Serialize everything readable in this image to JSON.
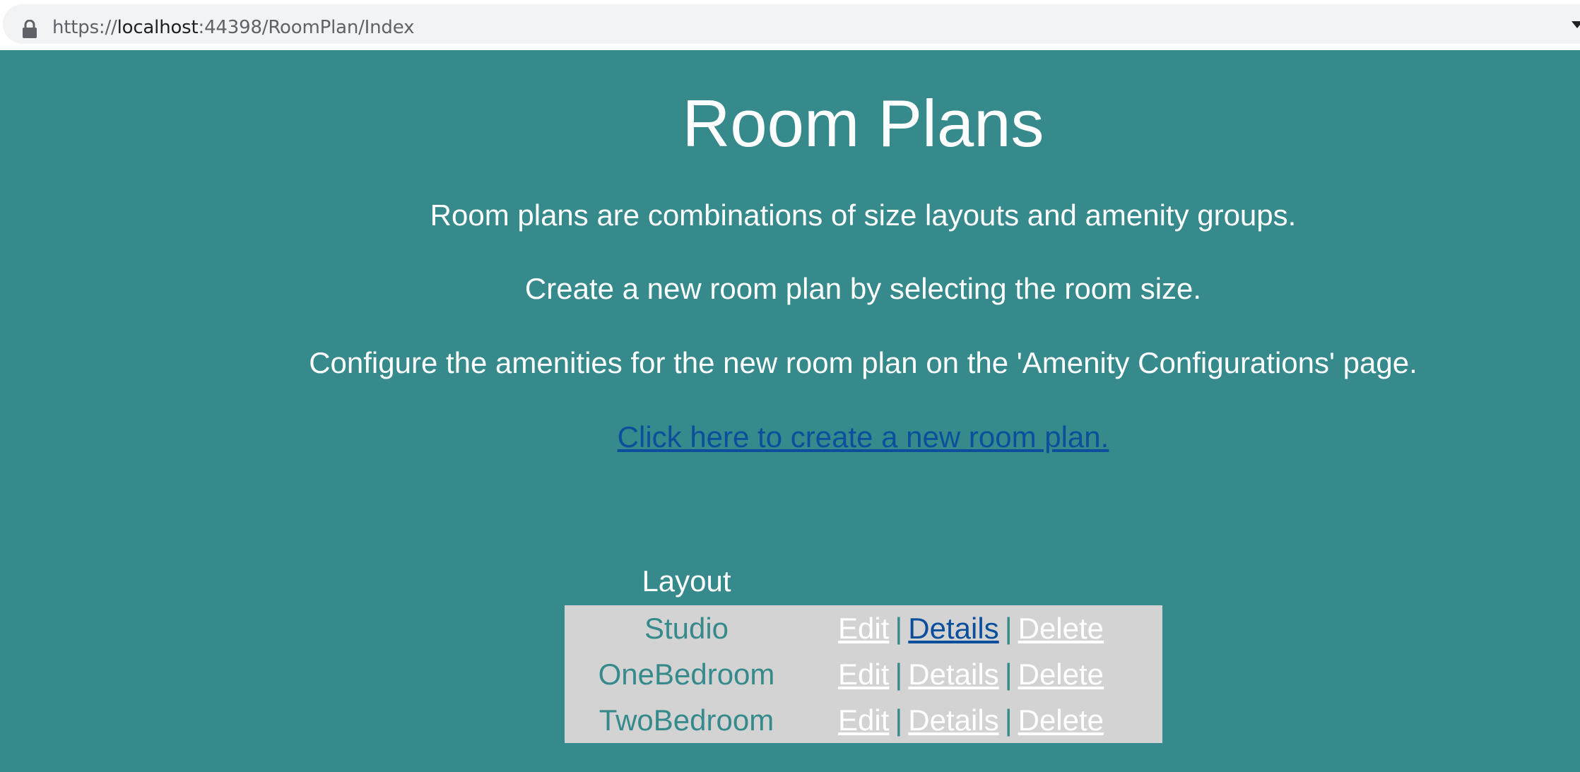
{
  "browser": {
    "url_scheme": "https://",
    "url_host": "localhost",
    "url_rest": ":44398/RoomPlan/Index"
  },
  "page": {
    "title": "Room Plans",
    "paragraphs": [
      "Room plans are combinations of size layouts and amenity groups.",
      "Create a new room plan by selecting the room size.",
      "Configure the amenities for the new room plan on the 'Amenity Configurations' page."
    ],
    "create_link": "Click here to create a new room plan."
  },
  "table": {
    "header_layout": "Layout",
    "rows": [
      {
        "layout": "Studio",
        "edit": "Edit",
        "details": "Details",
        "delete": "Delete"
      },
      {
        "layout": "OneBedroom",
        "edit": "Edit",
        "details": "Details",
        "delete": "Delete"
      },
      {
        "layout": "TwoBedroom",
        "edit": "Edit",
        "details": "Details",
        "delete": "Delete"
      }
    ],
    "separator": "|"
  },
  "colors": {
    "background": "#368a8c",
    "row_background": "#d3d3d3",
    "link_visited": "#0b4f9c",
    "text": "#ffffff"
  },
  "icons": {
    "lock": "lock-icon",
    "menu": "chevron-down-icon"
  }
}
